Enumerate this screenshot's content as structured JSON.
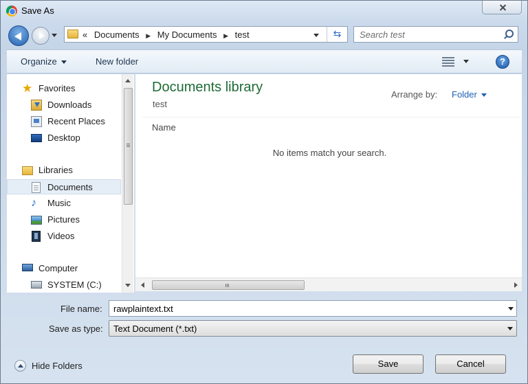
{
  "window": {
    "title": "Save As"
  },
  "address": {
    "crumbs": [
      "«",
      "Documents",
      "My Documents",
      "test"
    ]
  },
  "search": {
    "placeholder": "Search test"
  },
  "toolbar": {
    "organize_label": "Organize",
    "new_folder_label": "New folder",
    "help_label": "?"
  },
  "nav": {
    "items": [
      {
        "label": "Favorites"
      },
      {
        "label": "Downloads"
      },
      {
        "label": "Recent Places"
      },
      {
        "label": "Desktop"
      },
      {
        "label": "Libraries"
      },
      {
        "label": "Documents"
      },
      {
        "label": "Music"
      },
      {
        "label": "Pictures"
      },
      {
        "label": "Videos"
      },
      {
        "label": "Computer"
      },
      {
        "label": "SYSTEM (C:)"
      }
    ],
    "selected": "Documents"
  },
  "main": {
    "library_title": "Documents library",
    "library_subtitle": "test",
    "arrange_label": "Arrange by:",
    "arrange_value": "Folder",
    "column_name": "Name",
    "empty_message": "No items match your search."
  },
  "form": {
    "filename_label": "File name:",
    "filename_value": "rawplaintext.txt",
    "type_label": "Save as type:",
    "type_value": "Text Document (*.txt)"
  },
  "footer": {
    "hide_folders_label": "Hide Folders"
  },
  "buttons": {
    "save_label": "Save",
    "cancel_label": "Cancel"
  },
  "colors": {
    "library_title": "#1e6b36",
    "link_blue": "#1f5fb8"
  }
}
